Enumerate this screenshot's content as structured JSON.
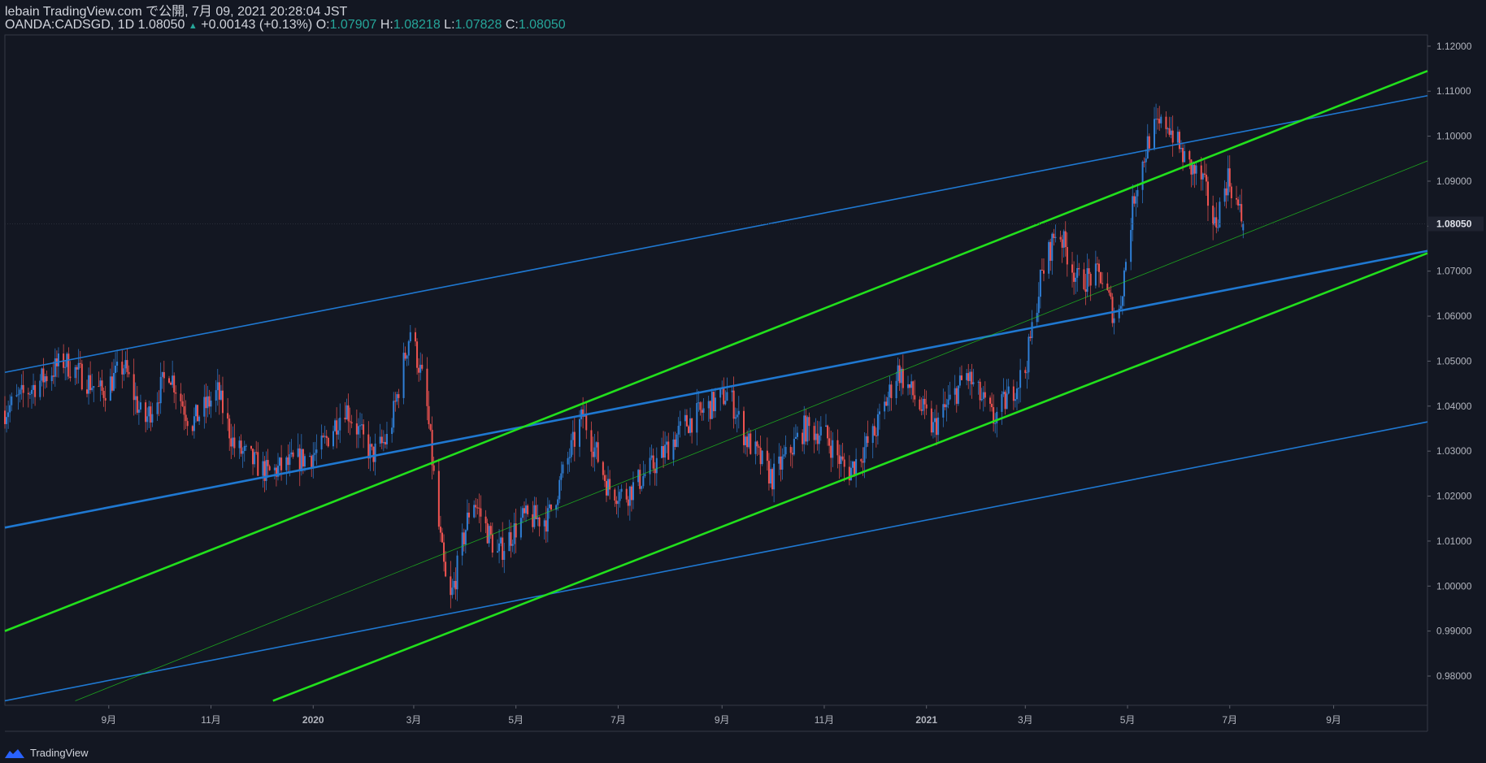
{
  "header": {
    "line1": "lebain TradingView.com で公開, 7月 09, 2021 20:28:04 JST",
    "symbol": "OANDA:CADSGD, 1D",
    "last": "1.08050",
    "change": "+0.00143 (+0.13%)",
    "o_label": "O:",
    "o": "1.07907",
    "h_label": "H:",
    "h": "1.08218",
    "l_label": "L:",
    "l": "1.07828",
    "c_label": "C:",
    "c": "1.08050"
  },
  "footer": {
    "brand": "TradingView"
  },
  "colors": {
    "background": "#131722",
    "up": "#2f7fd6",
    "down": "#ef5350",
    "blue_line": "#1f78d1",
    "green_line": "#22e01c",
    "axis_text": "#b2b5be"
  },
  "chart_data": {
    "type": "candlestick",
    "ylim": [
      0.9735,
      1.1225
    ],
    "y_ticks": [
      "1.12000",
      "1.11000",
      "1.10000",
      "1.09000",
      "1.08000",
      "1.07000",
      "1.06000",
      "1.05000",
      "1.04000",
      "1.03000",
      "1.02000",
      "1.01000",
      "1.00000",
      "0.99000",
      "0.98000"
    ],
    "x_ticks": [
      "9月",
      "11月",
      "2020",
      "3月",
      "5月",
      "7月",
      "9月",
      "11月",
      "2021",
      "3月",
      "5月",
      "7月",
      "9月"
    ],
    "x_range": [
      "2019-07-01",
      "2021-10-27"
    ],
    "last_price_label": "1.08050",
    "price_series": [
      [
        "2019-07-01",
        1.039
      ],
      [
        "2019-08-05",
        1.05
      ],
      [
        "2019-08-28",
        1.043
      ],
      [
        "2019-09-10",
        1.049
      ],
      [
        "2019-09-22",
        1.036
      ],
      [
        "2019-10-07",
        1.048
      ],
      [
        "2019-10-20",
        1.036
      ],
      [
        "2019-11-05",
        1.043
      ],
      [
        "2019-11-15",
        1.031
      ],
      [
        "2019-12-05",
        1.025
      ],
      [
        "2020-01-05",
        1.03
      ],
      [
        "2020-01-20",
        1.04
      ],
      [
        "2020-02-05",
        1.029
      ],
      [
        "2020-02-15",
        1.033
      ],
      [
        "2020-02-28",
        1.057
      ],
      [
        "2020-03-08",
        1.043
      ],
      [
        "2020-03-16",
        1.013
      ],
      [
        "2020-03-22",
        0.995
      ],
      [
        "2020-04-05",
        1.02
      ],
      [
        "2020-04-20",
        1.007
      ],
      [
        "2020-05-05",
        1.015
      ],
      [
        "2020-05-20",
        1.015
      ],
      [
        "2020-06-10",
        1.038
      ],
      [
        "2020-06-25",
        1.022
      ],
      [
        "2020-07-05",
        1.02
      ],
      [
        "2020-07-25",
        1.028
      ],
      [
        "2020-08-10",
        1.036
      ],
      [
        "2020-09-05",
        1.043
      ],
      [
        "2020-09-15",
        1.033
      ],
      [
        "2020-10-01",
        1.024
      ],
      [
        "2020-10-20",
        1.035
      ],
      [
        "2020-11-01",
        1.034
      ],
      [
        "2020-11-15",
        1.025
      ],
      [
        "2020-12-01",
        1.034
      ],
      [
        "2020-12-15",
        1.048
      ],
      [
        "2021-01-05",
        1.035
      ],
      [
        "2021-01-25",
        1.047
      ],
      [
        "2021-02-10",
        1.037
      ],
      [
        "2021-03-01",
        1.048
      ],
      [
        "2021-03-10",
        1.068
      ],
      [
        "2021-03-20",
        1.08
      ],
      [
        "2021-04-01",
        1.068
      ],
      [
        "2021-04-15",
        1.069
      ],
      [
        "2021-04-25",
        1.058
      ],
      [
        "2021-05-05",
        1.087
      ],
      [
        "2021-05-15",
        1.101
      ],
      [
        "2021-05-25",
        1.103
      ],
      [
        "2021-06-05",
        1.094
      ],
      [
        "2021-06-15",
        1.09
      ],
      [
        "2021-06-22",
        1.08
      ],
      [
        "2021-06-30",
        1.091
      ],
      [
        "2021-07-09",
        1.0805
      ]
    ],
    "trend_lines": [
      {
        "color": "blue",
        "weight": "thin",
        "from": [
          "2019-06-28",
          1.0475
        ],
        "to": [
          "2021-10-27",
          1.109
        ]
      },
      {
        "color": "blue",
        "weight": "thick",
        "from": [
          "2019-06-28",
          1.013
        ],
        "to": [
          "2021-10-27",
          1.0745
        ]
      },
      {
        "color": "blue",
        "weight": "thin",
        "from": [
          "2019-06-28",
          0.9745
        ],
        "to": [
          "2021-10-27",
          1.0365
        ]
      },
      {
        "color": "green",
        "weight": "thick",
        "from": [
          "2019-06-28",
          0.99
        ],
        "to": [
          "2021-10-27",
          1.1145
        ]
      },
      {
        "color": "green",
        "weight": "thick",
        "from": [
          "2019-12-08",
          0.9745
        ],
        "to": [
          "2021-10-27",
          1.074
        ]
      },
      {
        "color": "green",
        "weight": "hair",
        "from": [
          "2019-08-12",
          0.9745
        ],
        "to": [
          "2021-10-27",
          1.0945
        ]
      }
    ]
  }
}
